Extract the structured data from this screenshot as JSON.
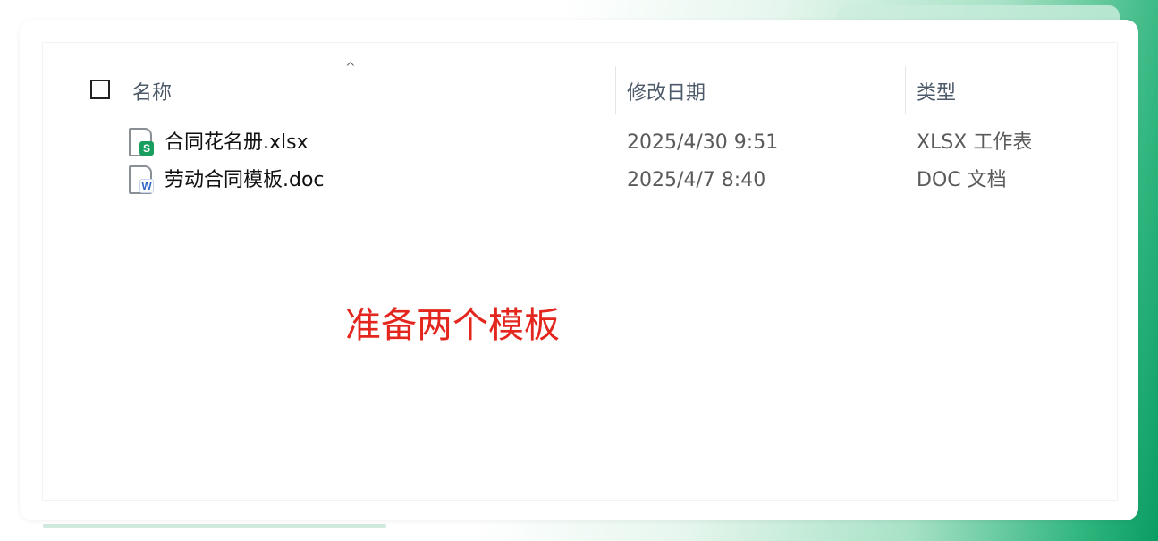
{
  "header": {
    "name_label": "名称",
    "date_label": "修改日期",
    "type_label": "类型",
    "sort_indicator": "^"
  },
  "files": [
    {
      "icon": "spreadsheet-file-icon",
      "badge_letter": "S",
      "badge_color": "#1a9e5f",
      "name": "合同花名册.xlsx",
      "modified": "2025/4/30 9:51",
      "type": "XLSX 工作表"
    },
    {
      "icon": "word-document-file-icon",
      "badge_letter": "W",
      "badge_color": "#2f64c8",
      "name": "劳动合同模板.doc",
      "modified": "2025/4/7 8:40",
      "type": "DOC 文档"
    }
  ],
  "annotation": "准备两个模板",
  "colors": {
    "accent_green": "#0a9d63",
    "annotation_red": "#e3261e"
  }
}
